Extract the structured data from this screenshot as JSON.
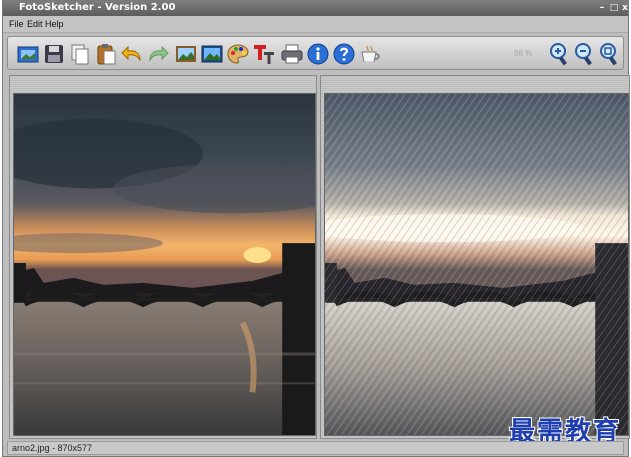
{
  "window": {
    "title": "FotoSketcher - Version 2.00"
  },
  "window_controls": {
    "minimize": "–",
    "maximize": "□",
    "close": "x"
  },
  "menu": {
    "items": [
      "File",
      "Edit",
      "Help"
    ]
  },
  "toolbar": {
    "buttons": [
      {
        "name": "open-image-button",
        "icon": "picture-folder-icon"
      },
      {
        "name": "save-button",
        "icon": "floppy-disk-icon"
      },
      {
        "name": "copy-button",
        "icon": "copy-pages-icon"
      },
      {
        "name": "paste-button",
        "icon": "clipboard-icon"
      },
      {
        "name": "undo-button",
        "icon": "undo-arrow-icon"
      },
      {
        "name": "redo-button",
        "icon": "redo-arrow-icon"
      },
      {
        "name": "original-image-button",
        "icon": "framed-photo-icon"
      },
      {
        "name": "landscape-image-button",
        "icon": "landscape-photo-icon"
      },
      {
        "name": "drawing-parameters-button",
        "icon": "palette-icon"
      },
      {
        "name": "text-tool-button",
        "icon": "text-tt-icon"
      },
      {
        "name": "print-button",
        "icon": "printer-icon"
      },
      {
        "name": "info-button",
        "icon": "info-icon"
      },
      {
        "name": "help-button",
        "icon": "question-icon"
      },
      {
        "name": "coffee-donate-button",
        "icon": "coffee-cup-icon"
      },
      {
        "name": "zoom-in-button",
        "icon": "zoom-in-icon"
      },
      {
        "name": "zoom-out-button",
        "icon": "zoom-out-icon"
      },
      {
        "name": "zoom-fit-button",
        "icon": "zoom-fit-icon"
      }
    ],
    "zoom_percent": "98 %"
  },
  "watermark": "最需教育",
  "status": {
    "text": "arno2.jpg - 870x577"
  },
  "colors": {
    "accent_blue": "#1f3fb0",
    "chrome": "#bdbdbd"
  }
}
